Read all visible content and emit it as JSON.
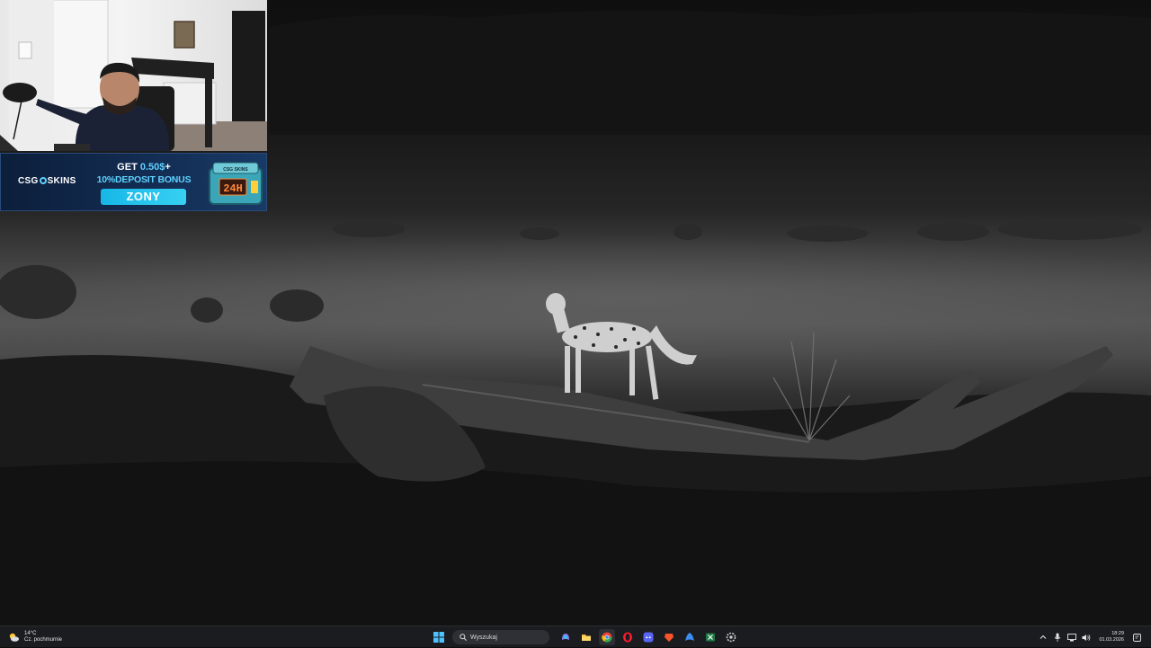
{
  "banner": {
    "brand_left": "CSG",
    "brand_right": "SKINS",
    "line1_prefix": "GET ",
    "line1_amount": "0.50$",
    "line1_suffix": "+",
    "line2": "10%DEPOSIT BONUS",
    "promo_code": "ZONY",
    "case_label": "24H",
    "case_brand": "CSG SKINS"
  },
  "taskbar": {
    "weather_temp": "14°C",
    "weather_desc": "Cz. pochmurnie",
    "search_placeholder": "Wyszukaj",
    "icons": [
      "start-icon",
      "copilot-icon",
      "file-explorer-icon",
      "chrome-icon",
      "opera-icon",
      "discord-icon",
      "brave-icon",
      "app-icon",
      "excel-icon",
      "settings-icon"
    ],
    "clock_time": "18:29",
    "clock_date": "01.03.2026"
  },
  "colors": {
    "taskbar_bg": "#1b1c20",
    "banner_accent": "#5fd2ff",
    "banner_bg": "#132c52"
  }
}
